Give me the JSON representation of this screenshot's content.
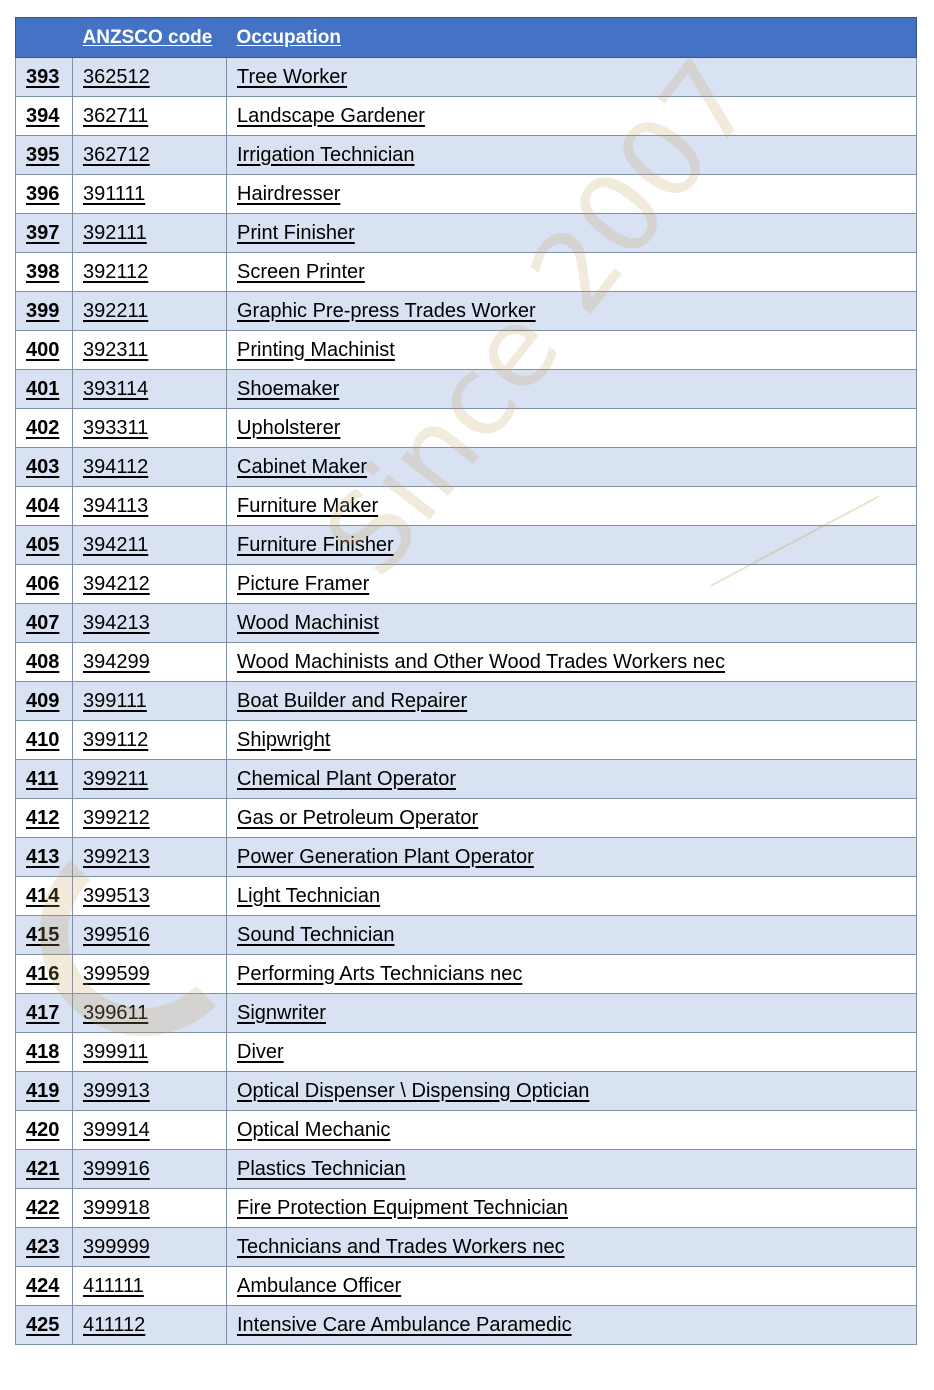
{
  "table": {
    "headers": {
      "number": "",
      "code": "ANZSCO code",
      "occupation": "Occupation"
    },
    "rows": [
      {
        "number": "393",
        "code": "362512",
        "occupation": "Tree Worker"
      },
      {
        "number": "394",
        "code": "362711",
        "occupation": "Landscape Gardener"
      },
      {
        "number": "395",
        "code": "362712",
        "occupation": "Irrigation Technician"
      },
      {
        "number": "396",
        "code": "391111",
        "occupation": "Hairdresser"
      },
      {
        "number": "397",
        "code": "392111",
        "occupation": "Print Finisher"
      },
      {
        "number": "398",
        "code": "392112",
        "occupation": "Screen Printer"
      },
      {
        "number": "399",
        "code": "392211",
        "occupation": "Graphic Pre-press Trades Worker"
      },
      {
        "number": "400",
        "code": "392311",
        "occupation": "Printing Machinist"
      },
      {
        "number": "401",
        "code": "393114",
        "occupation": "Shoemaker"
      },
      {
        "number": "402",
        "code": "393311",
        "occupation": "Upholsterer"
      },
      {
        "number": "403",
        "code": "394112",
        "occupation": "Cabinet Maker"
      },
      {
        "number": "404",
        "code": "394113",
        "occupation": "Furniture Maker"
      },
      {
        "number": "405",
        "code": "394211",
        "occupation": "Furniture Finisher"
      },
      {
        "number": "406",
        "code": "394212",
        "occupation": "Picture Framer"
      },
      {
        "number": "407",
        "code": "394213",
        "occupation": "Wood Machinist"
      },
      {
        "number": "408",
        "code": "394299",
        "occupation": "Wood Machinists and Other Wood Trades Workers nec"
      },
      {
        "number": "409",
        "code": "399111",
        "occupation": "Boat Builder and Repairer"
      },
      {
        "number": "410",
        "code": "399112",
        "occupation": "Shipwright"
      },
      {
        "number": "411",
        "code": "399211",
        "occupation": "Chemical Plant Operator"
      },
      {
        "number": "412",
        "code": "399212",
        "occupation": "Gas or Petroleum Operator"
      },
      {
        "number": "413",
        "code": "399213",
        "occupation": "Power Generation Plant Operator"
      },
      {
        "number": "414",
        "code": "399513",
        "occupation": "Light Technician"
      },
      {
        "number": "415",
        "code": "399516",
        "occupation": "Sound Technician"
      },
      {
        "number": "416",
        "code": "399599",
        "occupation": "Performing Arts Technicians nec"
      },
      {
        "number": "417",
        "code": "399611",
        "occupation": "Signwriter"
      },
      {
        "number": "418",
        "code": "399911",
        "occupation": "Diver"
      },
      {
        "number": "419",
        "code": "399913",
        "occupation": "Optical Dispenser \\ Dispensing Optician"
      },
      {
        "number": "420",
        "code": "399914",
        "occupation": "Optical Mechanic"
      },
      {
        "number": "421",
        "code": "399916",
        "occupation": "Plastics Technician"
      },
      {
        "number": "422",
        "code": "399918",
        "occupation": "Fire Protection Equipment Technician"
      },
      {
        "number": "423",
        "code": "399999",
        "occupation": "Technicians and Trades Workers nec"
      },
      {
        "number": "424",
        "code": "411111",
        "occupation": "Ambulance Officer"
      },
      {
        "number": "425",
        "code": "411112",
        "occupation": "Intensive Care Ambulance Paramedic"
      }
    ]
  },
  "watermark": {
    "text": "Since 2007"
  },
  "colors": {
    "header_bg": "#4472c4",
    "band_bg": "#d9e2f3",
    "watermark": "#c4a05a"
  }
}
